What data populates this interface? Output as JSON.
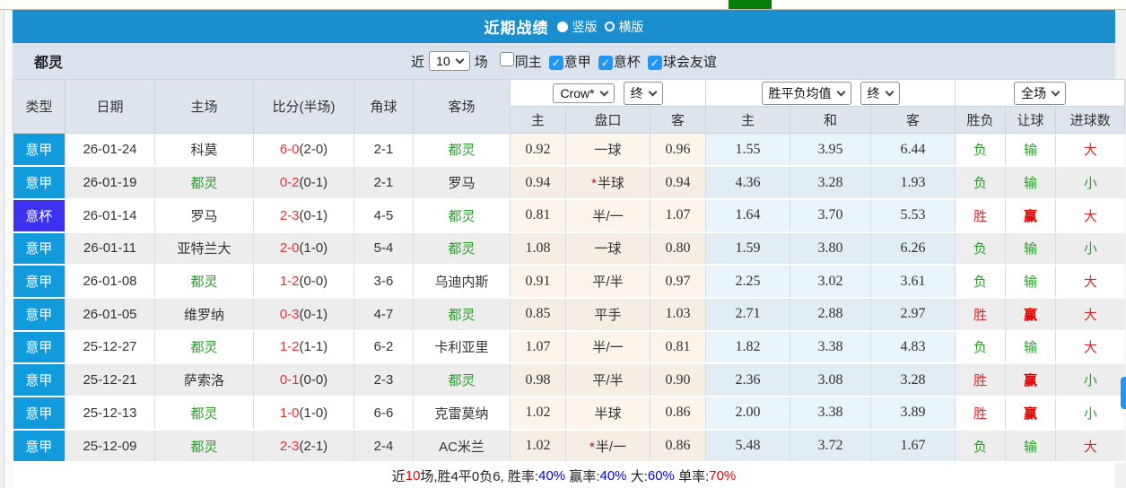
{
  "titlebar": {
    "title": "近期战绩",
    "view_options": [
      {
        "label": "竖版",
        "selected": true
      },
      {
        "label": "横版",
        "selected": false
      }
    ]
  },
  "filterbar": {
    "team": "都灵",
    "recent_label": "近",
    "recent_count": "10",
    "matches_label": "场",
    "checkboxes": [
      {
        "label": "同主",
        "checked": false
      },
      {
        "label": "意甲",
        "checked": true
      },
      {
        "label": "意杯",
        "checked": true
      },
      {
        "label": "球会友谊",
        "checked": true
      }
    ]
  },
  "table": {
    "static_headers": [
      "类型",
      "日期",
      "主场",
      "比分(半场)",
      "角球",
      "客场"
    ],
    "odds_group": {
      "bookmaker_select": "Crow*",
      "time_select": "终",
      "subheaders": [
        "主",
        "盘口",
        "客"
      ]
    },
    "avg_group": {
      "name_select": "胜平负均值",
      "time_select": "终",
      "subheaders": [
        "主",
        "和",
        "客"
      ]
    },
    "result_group": {
      "scope_select": "全场",
      "subheaders": [
        "胜负",
        "让球",
        "进球数"
      ]
    },
    "rows": [
      {
        "league": "意甲",
        "league_type": "league",
        "date": "26-01-24",
        "home": "科莫",
        "home_highlight": false,
        "score": "6-0",
        "half": "(2-0)",
        "corners": "2-1",
        "away": "都灵",
        "away_highlight": true,
        "crow_home": "0.92",
        "handicap": "一球",
        "handicap_star": false,
        "crow_away": "0.96",
        "avg_home": "1.55",
        "avg_draw": "3.95",
        "avg_away": "6.44",
        "result": "负",
        "result_color": "green",
        "handicap_result": "输",
        "handicap_result_color": "green",
        "goals": "大",
        "goals_color": "red"
      },
      {
        "league": "意甲",
        "league_type": "league",
        "date": "26-01-19",
        "home": "都灵",
        "home_highlight": true,
        "score": "0-2",
        "half": "(0-1)",
        "corners": "2-1",
        "away": "罗马",
        "away_highlight": false,
        "crow_home": "0.94",
        "handicap": "半球",
        "handicap_star": true,
        "crow_away": "0.94",
        "avg_home": "4.36",
        "avg_draw": "3.28",
        "avg_away": "1.93",
        "result": "负",
        "result_color": "green",
        "handicap_result": "输",
        "handicap_result_color": "green",
        "goals": "小",
        "goals_color": "green"
      },
      {
        "league": "意杯",
        "league_type": "cup",
        "date": "26-01-14",
        "home": "罗马",
        "home_highlight": false,
        "score": "2-3",
        "half": "(0-1)",
        "corners": "4-5",
        "away": "都灵",
        "away_highlight": true,
        "crow_home": "0.81",
        "handicap": "半/一",
        "handicap_star": false,
        "crow_away": "1.07",
        "avg_home": "1.64",
        "avg_draw": "3.70",
        "avg_away": "5.53",
        "result": "胜",
        "result_color": "red",
        "handicap_result": "赢",
        "handicap_result_color": "red",
        "goals": "大",
        "goals_color": "red"
      },
      {
        "league": "意甲",
        "league_type": "league",
        "date": "26-01-11",
        "home": "亚特兰大",
        "home_highlight": false,
        "score": "2-0",
        "half": "(1-0)",
        "corners": "5-4",
        "away": "都灵",
        "away_highlight": true,
        "crow_home": "1.08",
        "handicap": "一球",
        "handicap_star": false,
        "crow_away": "0.80",
        "avg_home": "1.59",
        "avg_draw": "3.80",
        "avg_away": "6.26",
        "result": "负",
        "result_color": "green",
        "handicap_result": "输",
        "handicap_result_color": "green",
        "goals": "小",
        "goals_color": "green"
      },
      {
        "league": "意甲",
        "league_type": "league",
        "date": "26-01-08",
        "home": "都灵",
        "home_highlight": true,
        "score": "1-2",
        "half": "(0-0)",
        "corners": "3-6",
        "away": "乌迪内斯",
        "away_highlight": false,
        "crow_home": "0.91",
        "handicap": "平/半",
        "handicap_star": false,
        "crow_away": "0.97",
        "avg_home": "2.25",
        "avg_draw": "3.02",
        "avg_away": "3.61",
        "result": "负",
        "result_color": "green",
        "handicap_result": "输",
        "handicap_result_color": "green",
        "goals": "大",
        "goals_color": "red"
      },
      {
        "league": "意甲",
        "league_type": "league",
        "date": "26-01-05",
        "home": "维罗纳",
        "home_highlight": false,
        "score": "0-3",
        "half": "(0-1)",
        "corners": "4-7",
        "away": "都灵",
        "away_highlight": true,
        "crow_home": "0.85",
        "handicap": "平手",
        "handicap_star": false,
        "crow_away": "1.03",
        "avg_home": "2.71",
        "avg_draw": "2.88",
        "avg_away": "2.97",
        "result": "胜",
        "result_color": "red",
        "handicap_result": "赢",
        "handicap_result_color": "red",
        "goals": "大",
        "goals_color": "red"
      },
      {
        "league": "意甲",
        "league_type": "league",
        "date": "25-12-27",
        "home": "都灵",
        "home_highlight": true,
        "score": "1-2",
        "half": "(1-1)",
        "corners": "6-2",
        "away": "卡利亚里",
        "away_highlight": false,
        "crow_home": "1.07",
        "handicap": "半/一",
        "handicap_star": false,
        "crow_away": "0.81",
        "avg_home": "1.82",
        "avg_draw": "3.38",
        "avg_away": "4.83",
        "result": "负",
        "result_color": "green",
        "handicap_result": "输",
        "handicap_result_color": "green",
        "goals": "大",
        "goals_color": "red"
      },
      {
        "league": "意甲",
        "league_type": "league",
        "date": "25-12-21",
        "home": "萨索洛",
        "home_highlight": false,
        "score": "0-1",
        "half": "(0-0)",
        "corners": "2-3",
        "away": "都灵",
        "away_highlight": true,
        "crow_home": "0.98",
        "handicap": "平/半",
        "handicap_star": false,
        "crow_away": "0.90",
        "avg_home": "2.36",
        "avg_draw": "3.08",
        "avg_away": "3.28",
        "result": "胜",
        "result_color": "red",
        "handicap_result": "赢",
        "handicap_result_color": "red",
        "goals": "小",
        "goals_color": "green"
      },
      {
        "league": "意甲",
        "league_type": "league",
        "date": "25-12-13",
        "home": "都灵",
        "home_highlight": true,
        "score": "1-0",
        "half": "(1-0)",
        "corners": "6-6",
        "away": "克雷莫纳",
        "away_highlight": false,
        "crow_home": "1.02",
        "handicap": "半球",
        "handicap_star": false,
        "crow_away": "0.86",
        "avg_home": "2.00",
        "avg_draw": "3.38",
        "avg_away": "3.89",
        "result": "胜",
        "result_color": "red",
        "handicap_result": "赢",
        "handicap_result_color": "red",
        "goals": "小",
        "goals_color": "green"
      },
      {
        "league": "意甲",
        "league_type": "league",
        "date": "25-12-09",
        "home": "都灵",
        "home_highlight": true,
        "score": "2-3",
        "half": "(2-1)",
        "corners": "2-4",
        "away": "AC米兰",
        "away_highlight": false,
        "crow_home": "1.02",
        "handicap": "半/一",
        "handicap_star": true,
        "crow_away": "0.86",
        "avg_home": "5.48",
        "avg_draw": "3.72",
        "avg_away": "1.67",
        "result": "负",
        "result_color": "green",
        "handicap_result": "输",
        "handicap_result_color": "green",
        "goals": "大",
        "goals_color": "red"
      }
    ]
  },
  "summary": {
    "segments": [
      {
        "text": "近",
        "color": "k"
      },
      {
        "text": "10",
        "color": "r"
      },
      {
        "text": "场,胜4平0负6, 胜率:",
        "color": "k"
      },
      {
        "text": "40%",
        "color": "b"
      },
      {
        "text": " 赢率:",
        "color": "k"
      },
      {
        "text": "40%",
        "color": "b"
      },
      {
        "text": " 大:",
        "color": "k"
      },
      {
        "text": "60%",
        "color": "b"
      },
      {
        "text": " 单率:",
        "color": "k"
      },
      {
        "text": "70%",
        "color": "r"
      }
    ]
  }
}
